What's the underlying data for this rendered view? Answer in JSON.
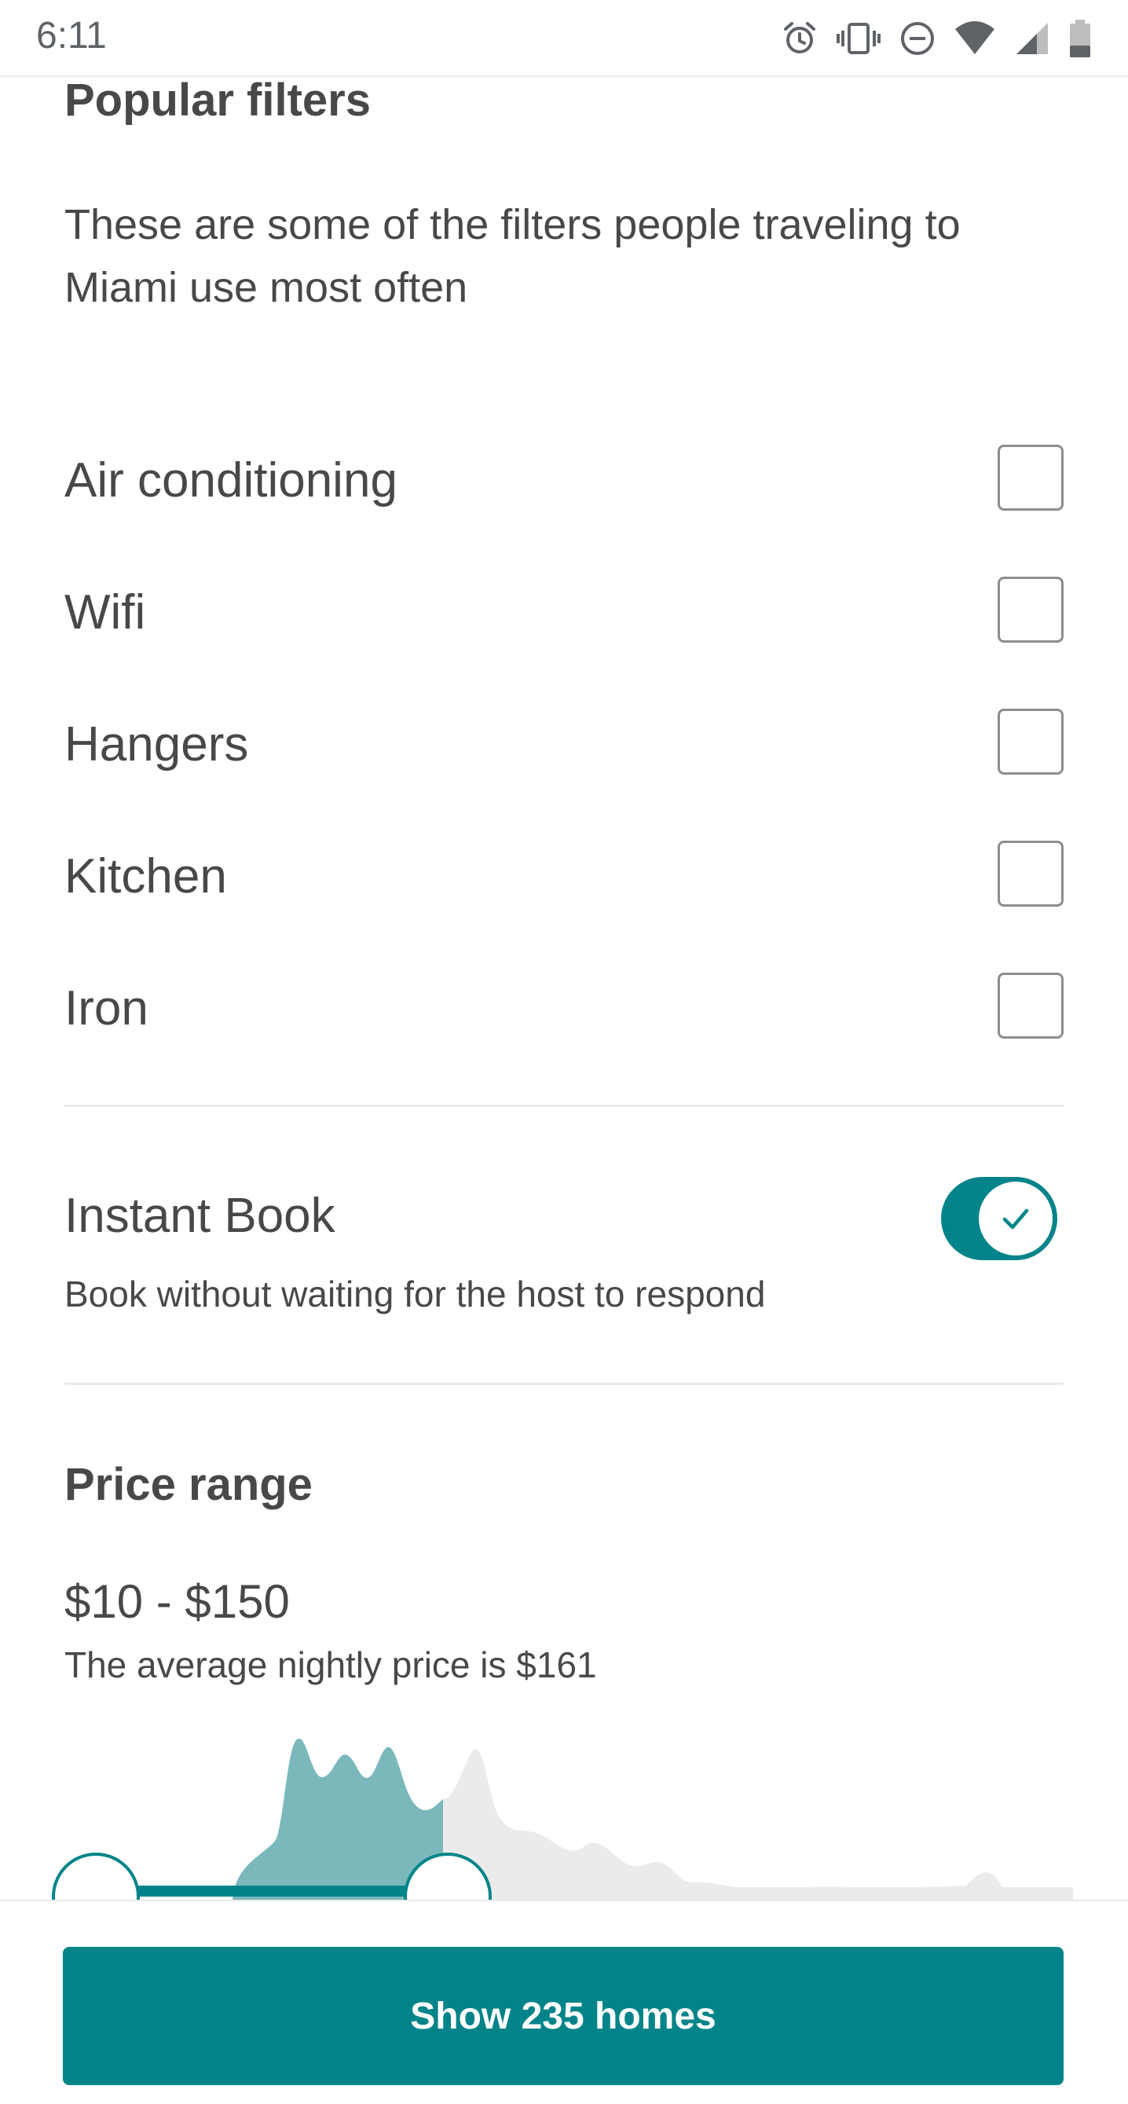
{
  "status_bar": {
    "time": "6:11",
    "icons": [
      "alarm-icon",
      "vibrate-icon",
      "do-not-disturb-icon",
      "wifi-icon",
      "signal-icon",
      "battery-icon"
    ]
  },
  "popular_filters": {
    "title": "Popular filters",
    "subtitle": "These are some of the filters people traveling to Miami use most often",
    "items": [
      {
        "label": "Air conditioning",
        "checked": false
      },
      {
        "label": "Wifi",
        "checked": false
      },
      {
        "label": "Hangers",
        "checked": false
      },
      {
        "label": "Kitchen",
        "checked": false
      },
      {
        "label": "Iron",
        "checked": false
      }
    ]
  },
  "instant_book": {
    "title": "Instant Book",
    "description": "Book without waiting for the host to respond",
    "enabled": true
  },
  "price": {
    "title": "Price range",
    "range": "$10 - $150",
    "average": "The average nightly price is $161"
  },
  "footer": {
    "button_label": "Show 235 homes"
  },
  "colors": {
    "accent": "#008489",
    "histogram_selected": "#7ab8bc",
    "histogram_unselected": "#ebebeb",
    "text": "#484848"
  }
}
